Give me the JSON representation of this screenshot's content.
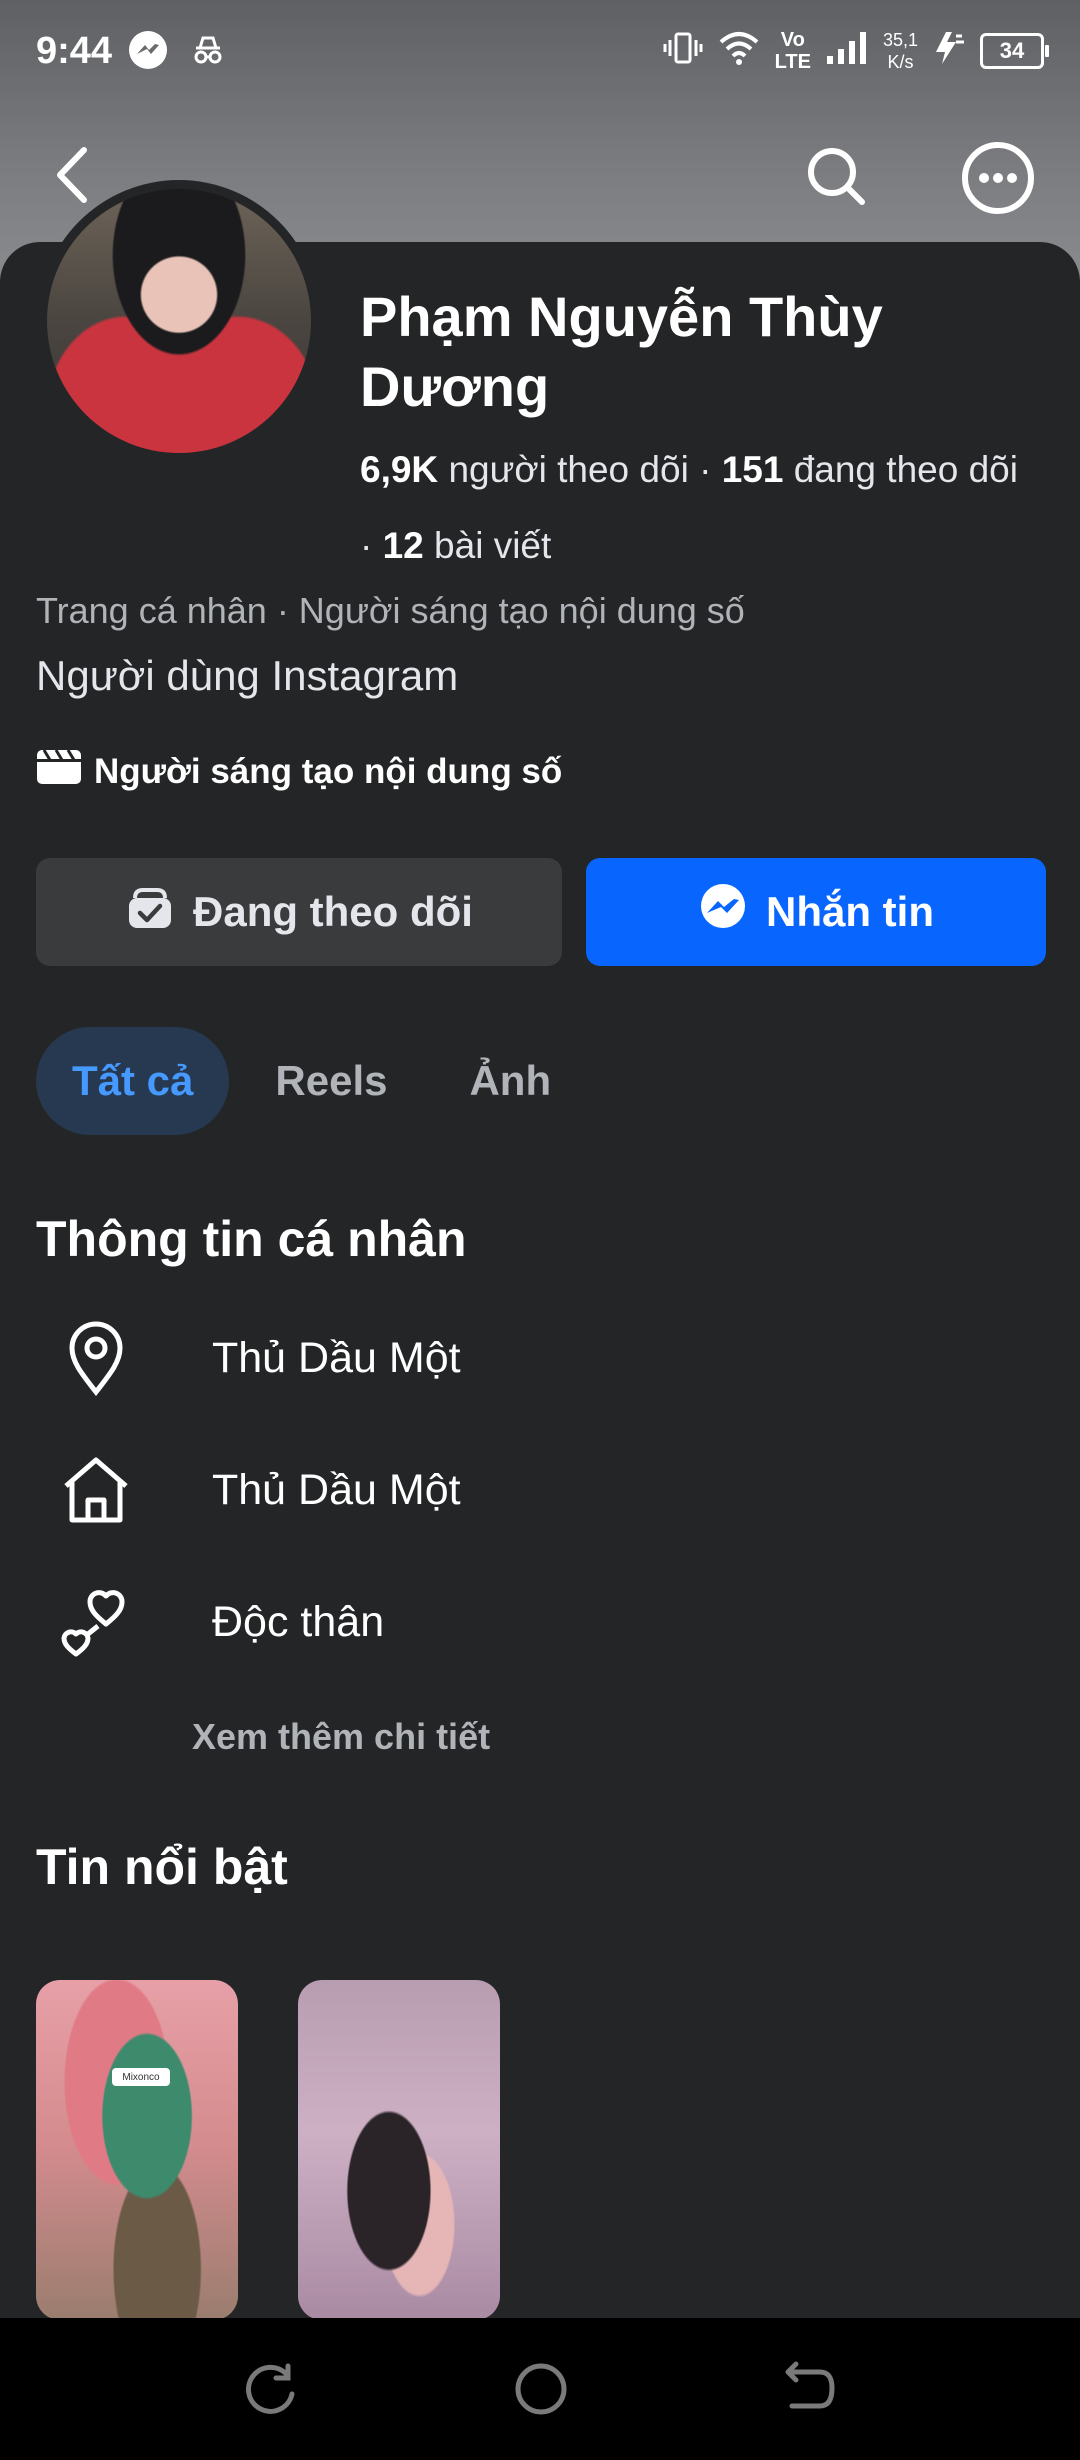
{
  "status_bar": {
    "time": "9:44",
    "speed_value": "35,1",
    "speed_unit": "K/s",
    "battery": "34",
    "volte_top": "Vo",
    "volte_bottom": "LTE"
  },
  "profile": {
    "name": "Phạm Nguyễn Thùy Dương",
    "followers_count": "6,9K",
    "followers_label": "người theo dõi",
    "following_count": "151",
    "following_label": "đang theo dõi",
    "posts_count": "12",
    "posts_label": "bài viết",
    "category": "Trang cá nhân · Người sáng tạo nội dung số",
    "bio": "Người dùng Instagram",
    "creator_label": "Người sáng tạo nội dung số"
  },
  "actions": {
    "follow_label": "Đang theo dõi",
    "message_label": "Nhắn tin"
  },
  "tabs": [
    {
      "label": "Tất cả",
      "active": true
    },
    {
      "label": "Reels",
      "active": false
    },
    {
      "label": "Ảnh",
      "active": false
    }
  ],
  "about": {
    "title": "Thông tin cá nhân",
    "location": "Thủ Dầu Một",
    "hometown": "Thủ Dầu Một",
    "relationship": "Độc thân",
    "see_more": "Xem thêm chi tiết"
  },
  "highlights": {
    "title": "Tin nổi bật",
    "story_1_tag": "Mixonco"
  },
  "colors": {
    "background": "#242526",
    "accent": "#0866ff",
    "active_tab_bg": "#263951",
    "active_tab_text": "#4599ff"
  }
}
